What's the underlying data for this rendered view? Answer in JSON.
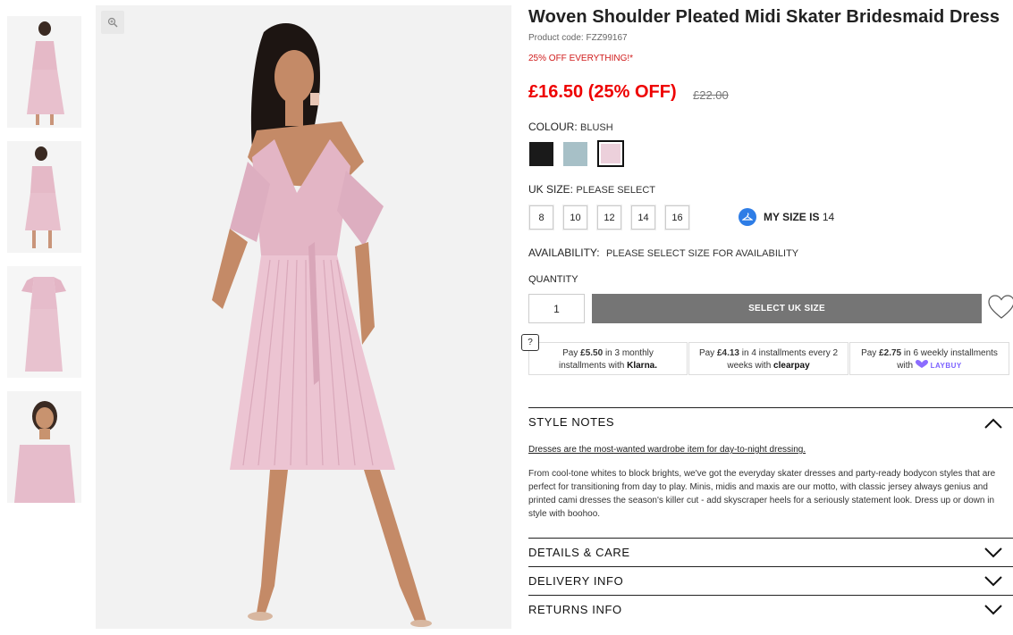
{
  "product": {
    "title": "Woven Shoulder Pleated Midi Skater Bridesmaid Dress",
    "code_text": "Product code: FZZ99167",
    "promo": "25% OFF EVERYTHING!*",
    "price": "£16.50 (25% OFF)",
    "old_price": "£22.00"
  },
  "colour": {
    "label": "COLOUR:",
    "value": "BLUSH",
    "swatches": [
      {
        "name": "black",
        "color": "#1a1a1a"
      },
      {
        "name": "sage-blue",
        "color": "#a7c0c7"
      },
      {
        "name": "blush",
        "color": "#ecd0db",
        "selected": true
      }
    ]
  },
  "size": {
    "label": "UK SIZE:",
    "value": "PLEASE SELECT",
    "options": [
      "8",
      "10",
      "12",
      "14",
      "16"
    ],
    "my_size_label": "MY SIZE IS",
    "my_size_value": "14"
  },
  "availability": {
    "label": "AVAILABILITY:",
    "value": "PLEASE SELECT SIZE FOR AVAILABILITY"
  },
  "quantity": {
    "label": "QUANTITY",
    "value": "1"
  },
  "cta": {
    "select_label": "SELECT UK SIZE"
  },
  "payments": {
    "help": "?",
    "klarna": {
      "pre": "Pay ",
      "amount": "£5.50",
      "mid": " in 3 monthly",
      "line2": "installments with ",
      "brand": "Klarna."
    },
    "clearpay": {
      "pre": "Pay ",
      "amount": "£4.13",
      "mid": " in 4 installments every 2",
      "line2": "weeks with ",
      "brand": "clearpay"
    },
    "laybuy": {
      "pre": "Pay ",
      "amount": "£2.75",
      "mid": " in 6 weekly installments",
      "line2": "with ",
      "brand": "LAYBUY"
    }
  },
  "accordion": {
    "style_notes": "STYLE NOTES",
    "details_care": "DETAILS & CARE",
    "delivery": "DELIVERY INFO",
    "returns": "RETURNS INFO"
  },
  "style_notes": {
    "lead": "Dresses are the most-wanted wardrobe item for day-to-night dressing.",
    "body": "From cool-tone whites to block brights, we've got the everyday skater dresses and party-ready bodycon styles that are perfect for transitioning from day to play. Minis, midis and maxis are our motto, with classic jersey always genius and printed cami dresses the season's killer cut - add skyscraper heels for a seriously statement look. Dress up or down in style with boohoo."
  },
  "icons": [
    "zoom-icon",
    "hanger-icon",
    "heart-icon",
    "chevron-up-icon",
    "chevron-down-icon"
  ]
}
